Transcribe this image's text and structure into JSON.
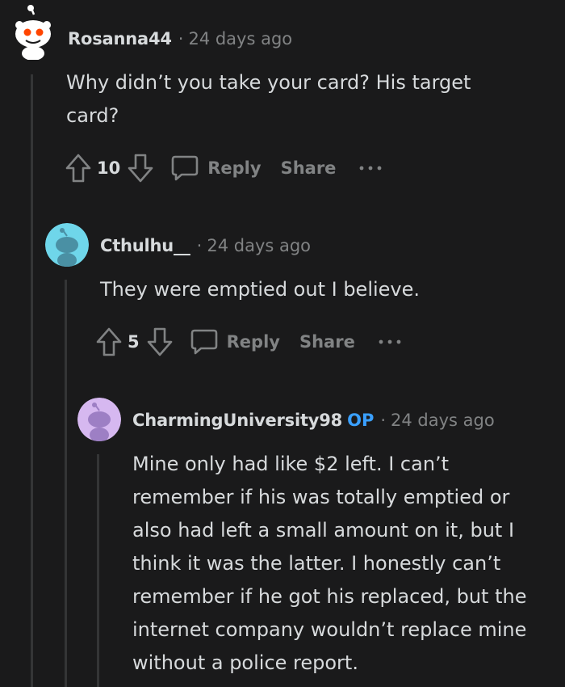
{
  "comments": [
    {
      "username": "Rosanna44",
      "op": "",
      "separator": "·",
      "timestamp": "24 days ago",
      "body": "Why didn’t you take your card? His target card?",
      "votes": "10",
      "reply_label": "Reply",
      "share_label": "Share",
      "avatar_color": "#ffffff",
      "avatar_bg": "#1a1a1b"
    },
    {
      "username": "Cthulhu__",
      "op": "",
      "separator": "·",
      "timestamp": "24 days ago",
      "body": "They were emptied out I believe.",
      "votes": "5",
      "reply_label": "Reply",
      "share_label": "Share",
      "avatar_color": "#4fbdd8",
      "avatar_bg": "#6fd6ea"
    },
    {
      "username": "CharmingUniversity98",
      "op": "OP",
      "separator": "·",
      "timestamp": "24 days ago",
      "body": "Mine only had like $2 left. I can’t remember if his was totally emptied or also had left a small amount on it, but I think it was the latter. I honestly can’t remember if he got his replaced, but the internet company wouldn’t replace mine without a police report.",
      "avatar_color": "#9d7fc4",
      "avatar_bg": "#d6b8f0"
    }
  ],
  "colors": {
    "background": "#1a1a1b",
    "text": "#d7dadc",
    "muted": "#818384",
    "op_blue": "#3aa0ff",
    "thread_line": "#343536"
  }
}
